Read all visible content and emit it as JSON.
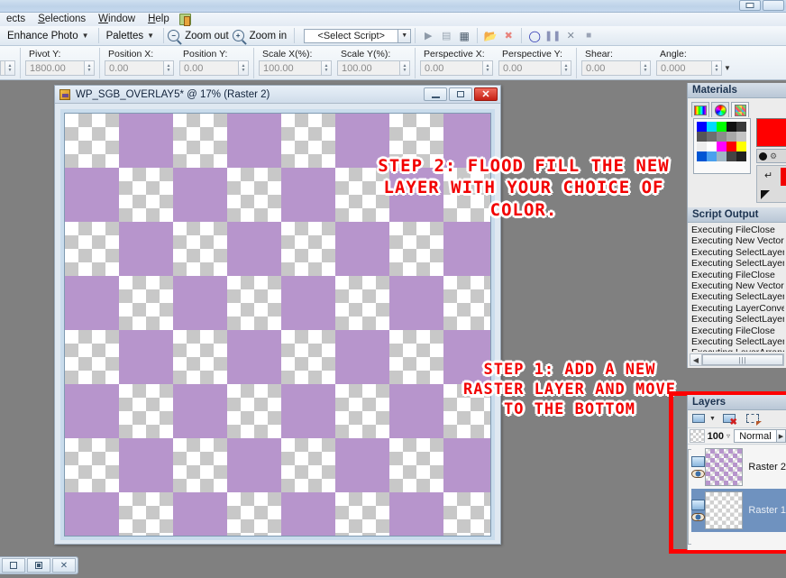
{
  "window": {
    "restore_glyph": "restore-icon"
  },
  "menubar": {
    "items": [
      {
        "label": "ects",
        "accel": ""
      },
      {
        "label": "Selections",
        "accel": "S"
      },
      {
        "label": "Window",
        "accel": "W"
      },
      {
        "label": "Help",
        "accel": "H"
      }
    ],
    "trailing_icon": "learning-center-icon"
  },
  "toolbar": {
    "enhance_photo": "Enhance Photo",
    "palettes": "Palettes",
    "zoom_out": "Zoom out",
    "zoom_in": "Zoom in",
    "script_select_value": "<Select Script>",
    "script_buttons": [
      {
        "name": "run-script-button",
        "glyph": "▶"
      },
      {
        "name": "run-multiple-script-button",
        "glyph": "▤"
      },
      {
        "name": "edit-script-button",
        "glyph": "▦"
      },
      {
        "name": "open-script-button",
        "glyph": "📁"
      },
      {
        "name": "stop-script-button",
        "glyph": "⊗"
      },
      {
        "name": "record-script-button",
        "glyph": "●"
      },
      {
        "name": "pause-script-button",
        "glyph": "‖"
      },
      {
        "name": "cancel-script-button",
        "glyph": "✕"
      },
      {
        "name": "save-script-button",
        "glyph": "■"
      }
    ]
  },
  "options_bar": {
    "fields": [
      {
        "label": "Pivot Y:",
        "value": "1800.00",
        "width": 66
      },
      {
        "label": "Position X:",
        "value": "0.00",
        "width": 66
      },
      {
        "label": "Position Y:",
        "value": "0.00",
        "width": 66
      },
      {
        "label": "Scale X(%):",
        "value": "100.00",
        "width": 72
      },
      {
        "label": "Scale Y(%):",
        "value": "100.00",
        "width": 72
      },
      {
        "label": "Perspective X:",
        "value": "0.00",
        "width": 72
      },
      {
        "label": "Perspective Y:",
        "value": "0.00",
        "width": 72
      },
      {
        "label": "Shear:",
        "value": "0.00",
        "width": 66
      },
      {
        "label": "Angle:",
        "value": "0.000",
        "width": 66
      }
    ]
  },
  "document": {
    "title": "WP_SGB_OVERLAY5* @  17% (Raster 2)",
    "minimize_label": "",
    "maximize_label": "",
    "close_label": "✕",
    "canvas": {
      "purple_color": "#b795cc",
      "checker_light": "#ffffff",
      "checker_dark": "#c8c8c8",
      "frame_color": "#c9dcec"
    }
  },
  "annotations": {
    "step2": "STEP 2: FLOOD FILL THE NEW LAYER WITH YOUR CHOICE OF COLOR.",
    "step1": "STEP 1: ADD A NEW RASTER LAYER AND MOVE TO THE BOTTOM",
    "highlight_color": "#fe0000",
    "text_color": "#f20000"
  },
  "materials": {
    "title": "Materials",
    "tabs": [
      {
        "name": "frame-tab",
        "icon": "color-frame-icon"
      },
      {
        "name": "rainbow-tab",
        "icon": "color-wheel-icon"
      },
      {
        "name": "swatches-tab",
        "icon": "swatches-icon"
      }
    ],
    "palette_colors": [
      "#0000ff",
      "#00d9ff",
      "#00ff00",
      "#111111",
      "#3a3a3a",
      "#555555",
      "#6e6e6e",
      "#8c8c8c",
      "#a8a8a8",
      "#c4c4c4",
      "#ededed",
      "#ffffff",
      "#ff00ff",
      "#ff0000",
      "#ffff00",
      "#0055d4",
      "#4aa0ee",
      "#9fb6c4",
      "#444444",
      "#222222"
    ],
    "foreground_color": "#ff0000",
    "background_color": "#ff0000"
  },
  "script_output": {
    "title": "Script Output",
    "lines": [
      "Executing FileClose",
      "Executing New Vector La",
      "Executing SelectLayer",
      "Executing SelectLayer",
      "Executing FileClose",
      "Executing New Vector La",
      "Executing SelectLayer",
      "Executing LayerConvertT",
      "Executing SelectLayer",
      "Executing FileClose",
      "Executing SelectLayer",
      "Executing LayerArrange"
    ],
    "scroll_thumb_glyph": "‖‖",
    "scroll_left_glyph": "◀"
  },
  "layers": {
    "title": "Layers",
    "tools": [
      {
        "name": "new-raster-layer-button",
        "icon": "new-layer-icon"
      },
      {
        "name": "delete-layer-button",
        "icon": "delete-layer-icon"
      },
      {
        "name": "layer-properties-button",
        "icon": "layer-properties-icon"
      }
    ],
    "opacity_value": "100",
    "blend_mode": "Normal",
    "rows": [
      {
        "name": "Raster 2",
        "visible": true,
        "selected": false,
        "thumb": "purple"
      },
      {
        "name": "Raster 1",
        "visible": true,
        "selected": true,
        "thumb": "clear"
      }
    ]
  },
  "mdi_buttons": [
    {
      "name": "mdi-minimize-button",
      "glyph": "minimize-icon"
    },
    {
      "name": "mdi-restore-button",
      "glyph": "restore-icon"
    },
    {
      "name": "mdi-close-button",
      "glyph": "✕"
    }
  ]
}
